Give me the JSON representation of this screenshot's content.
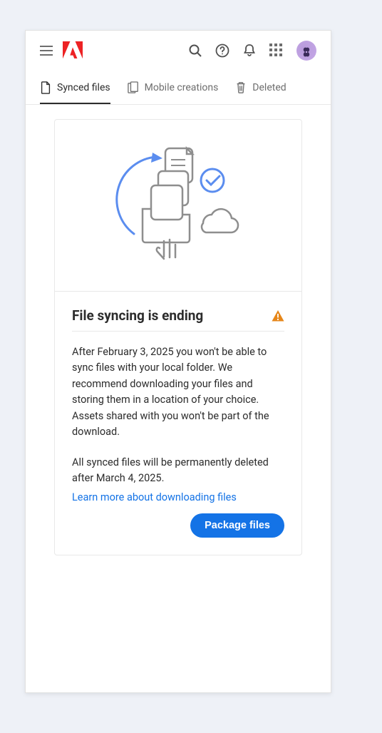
{
  "header": {
    "icons": {
      "menu": "menu-icon",
      "logo": "adobe-logo",
      "search": "search-icon",
      "help": "help-icon",
      "notifications": "bell-icon",
      "apps": "apps-grid-icon",
      "avatar": "user-avatar"
    }
  },
  "tabs": [
    {
      "label": "Synced files",
      "icon": "file-icon",
      "active": true
    },
    {
      "label": "Mobile creations",
      "icon": "mobile-creations-icon",
      "active": false
    },
    {
      "label": "Deleted",
      "icon": "trash-icon",
      "active": false
    }
  ],
  "card": {
    "title": "File syncing is ending",
    "warning_icon": "warning-icon",
    "paragraph1": "After February 3, 2025 you won't be able to sync files with your local folder. We recommend downloading your files and storing them in a location of your choice. Assets shared with you won't be part of the download.",
    "paragraph2": "All synced files will be permanently deleted after March 4, 2025.",
    "learn_link": "Learn more about downloading files",
    "button_label": "Package files"
  },
  "colors": {
    "accent_blue": "#1473e6",
    "adobe_red": "#ED2224",
    "warning_orange": "#e68619"
  }
}
